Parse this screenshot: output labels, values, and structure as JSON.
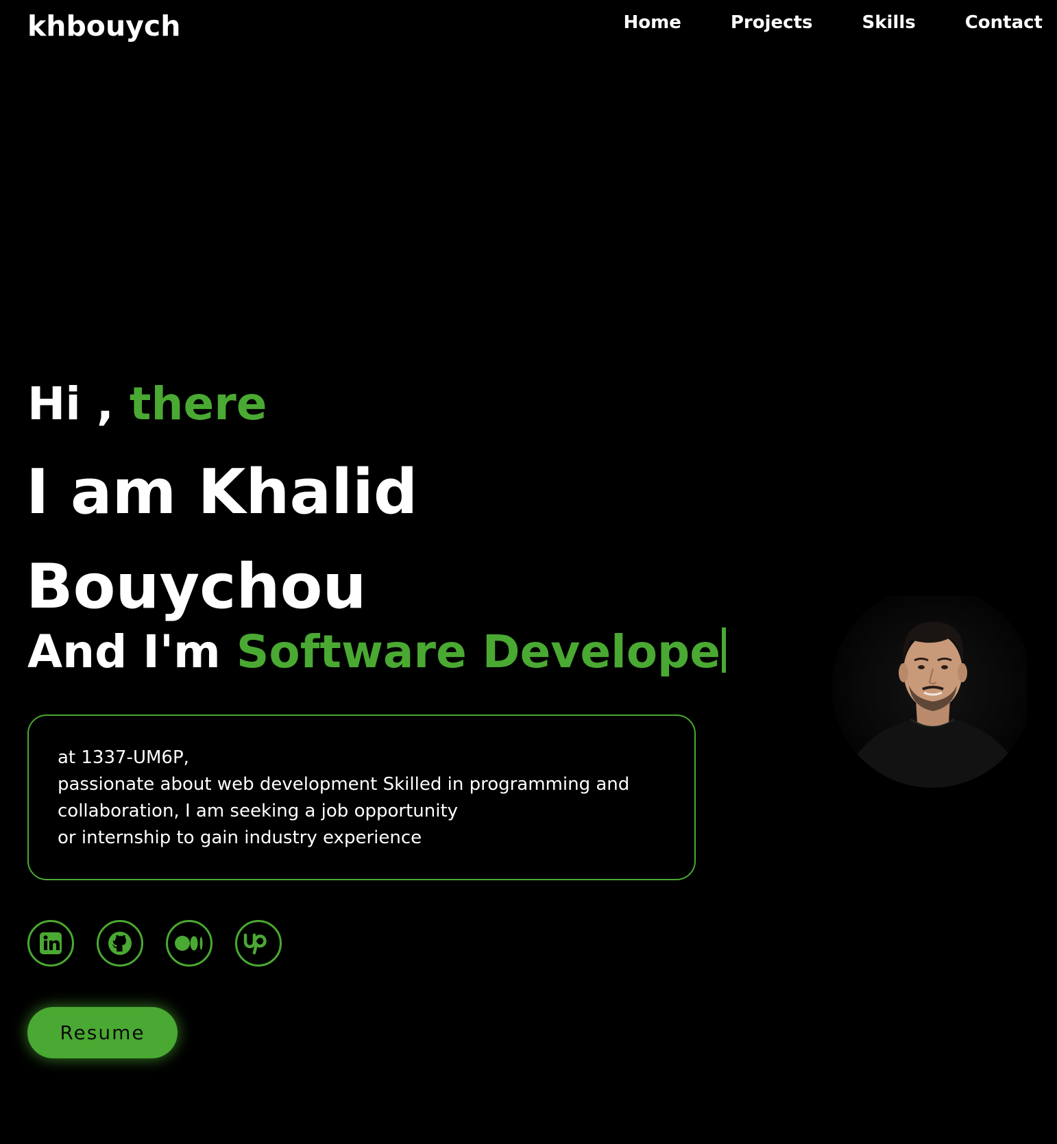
{
  "header": {
    "logo": "khbouych",
    "nav": [
      "Home",
      "Projects",
      "Skills",
      "Contact"
    ]
  },
  "hero": {
    "greeting_prefix": "Hi ,",
    "greeting_highlight": "there",
    "name_line1": "I am Khalid",
    "name_line2": "Bouychou",
    "role_prefix": "And I'm",
    "role_highlight": "Software Develope"
  },
  "about": {
    "lines": [
      "at 1337-UM6P,",
      "passionate about web development Skilled in programming and",
      "collaboration, I am seeking a job opportunity",
      "or internship to gain industry experience"
    ]
  },
  "socials": [
    {
      "icon": "linkedin-icon"
    },
    {
      "icon": "github-icon"
    },
    {
      "icon": "medium-icon"
    },
    {
      "icon": "upwork-icon"
    }
  ],
  "actions": {
    "resume_label": "Resume"
  },
  "colors": {
    "accent": "#4aa932",
    "background": "#000000",
    "text": "#ffffff"
  }
}
